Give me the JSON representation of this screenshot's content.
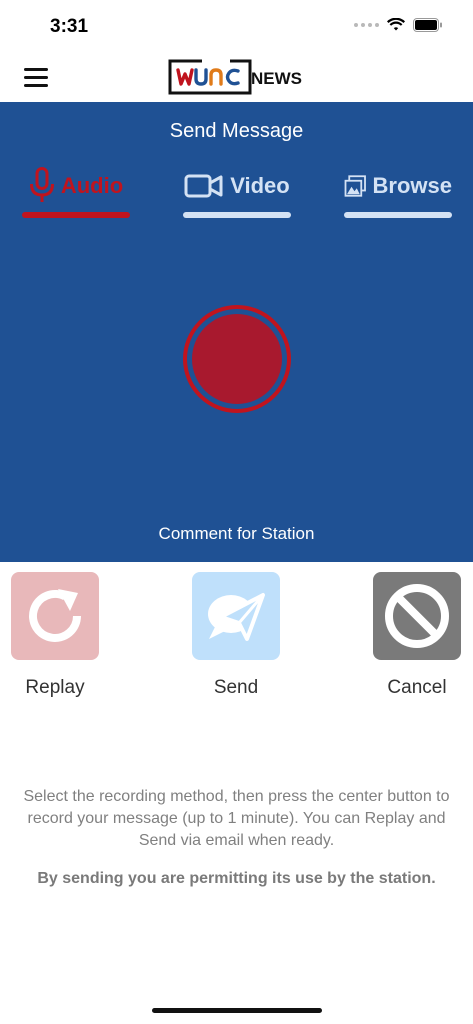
{
  "status_bar": {
    "time": "3:31"
  },
  "header": {
    "logo": {
      "wordmark": "WUNC",
      "suffix": "NEWS"
    }
  },
  "panel": {
    "title": "Send Message",
    "tabs": [
      {
        "label": "Audio",
        "icon": "microphone-icon",
        "active": true
      },
      {
        "label": "Video",
        "icon": "video-camera-icon",
        "active": false
      },
      {
        "label": "Browse",
        "icon": "photo-gallery-icon",
        "active": false
      }
    ],
    "record_button": {
      "icon": "record-icon"
    },
    "caption": "Comment for Station"
  },
  "actions": [
    {
      "label": "Replay",
      "icon": "replay-icon"
    },
    {
      "label": "Send",
      "icon": "send-icon"
    },
    {
      "label": "Cancel",
      "icon": "cancel-icon"
    }
  ],
  "instructions": "Select the recording method, then press the center button to record your message (up to 1 minute). You can Replay and Send via email when ready.",
  "permission_notice": "By sending you are permitting its use by the station.",
  "colors": {
    "panel_blue": "#1f5194",
    "accent_red": "#c0141e",
    "record_red": "#a8192e",
    "inactive_tab": "#d4e2f4",
    "replay_tile": "#e8b8ba",
    "send_tile": "#bfe0fb",
    "cancel_tile": "#7a7a7a"
  }
}
